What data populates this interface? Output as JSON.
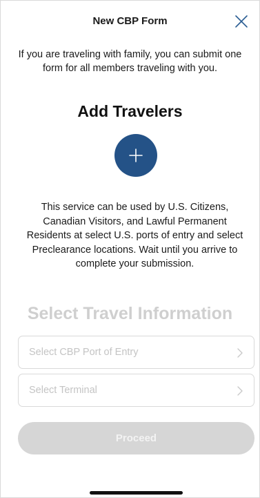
{
  "header": {
    "title": "New CBP Form",
    "close_icon": "close-icon"
  },
  "intro_text": "If you are traveling with family, you can submit one form for all members traveling with you.",
  "add_travelers": {
    "heading": "Add Travelers",
    "button_icon": "plus-icon",
    "button_color": "#245287"
  },
  "info_text": "This service can be used by U.S. Citizens, Canadian Visitors, and Lawful Permanent Residents at select U.S. ports of entry and select Preclearance locations. Wait until you arrive to complete your submission.",
  "travel_info": {
    "heading": "Select Travel Information",
    "port_label": "Select CBP Port of Entry",
    "terminal_label": "Select Terminal",
    "chevron_icon": "chevron-right-icon"
  },
  "proceed": {
    "label": "Proceed",
    "state": "disabled"
  }
}
